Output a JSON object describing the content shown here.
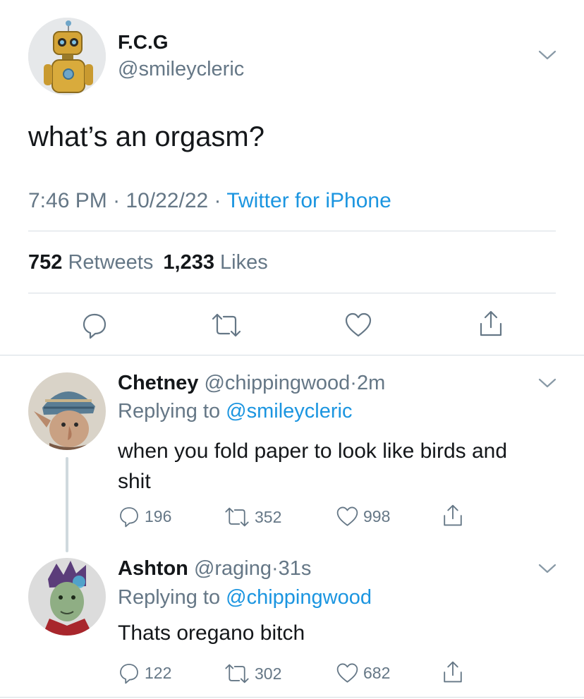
{
  "main_tweet": {
    "display_name": "F.C.G",
    "handle": "@smileycleric",
    "text": "what’s an orgasm?",
    "time": "7:46 PM",
    "date": "10/22/22",
    "separator": "·",
    "source": "Twitter for iPhone",
    "retweets_count": "752",
    "retweets_label": "Retweets",
    "likes_count": "1,233",
    "likes_label": "Likes",
    "avatar_icon": "robot-avatar"
  },
  "replies": [
    {
      "display_name": "Chetney",
      "handle": "@chippingwood",
      "separator": "·",
      "age": "2m",
      "replying_label": "Replying to",
      "replying_to": "@smileycleric",
      "text_line1": "when you fold paper to look like birds and",
      "text_line2": "shit",
      "replies": "196",
      "retweets": "352",
      "likes": "998",
      "avatar_icon": "gnome-in-beanie-avatar"
    },
    {
      "display_name": "Ashton",
      "handle": "@raging",
      "separator": "·",
      "age": "31s",
      "replying_label": "Replying to",
      "replying_to": "@chippingwood",
      "text_line1": "Thats oregano bitch",
      "replies": "122",
      "retweets": "302",
      "likes": "682",
      "avatar_icon": "green-skinned-character-avatar"
    }
  ],
  "colors": {
    "link": "#1b95e0",
    "muted": "#657786",
    "text": "#14171a",
    "divider": "#d6dde3"
  }
}
